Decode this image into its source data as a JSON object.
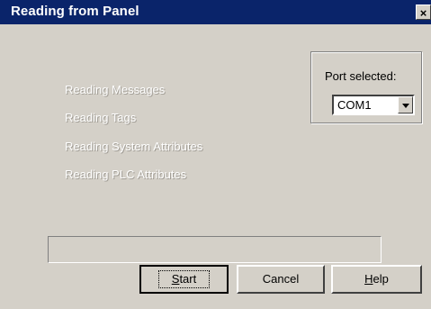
{
  "window": {
    "title": "Reading from Panel",
    "close_glyph": "×"
  },
  "steps": [
    "Reading Messages",
    "Reading Tags",
    "Reading System Attributes",
    "Reading PLC Attributes"
  ],
  "port": {
    "label": "Port selected:",
    "value": "COM1"
  },
  "progress": {
    "value": 0
  },
  "buttons": {
    "start": "Start",
    "cancel": "Cancel",
    "help": "Help"
  },
  "colors": {
    "titlebar": "#0a246a",
    "face": "#d4d0c8"
  }
}
